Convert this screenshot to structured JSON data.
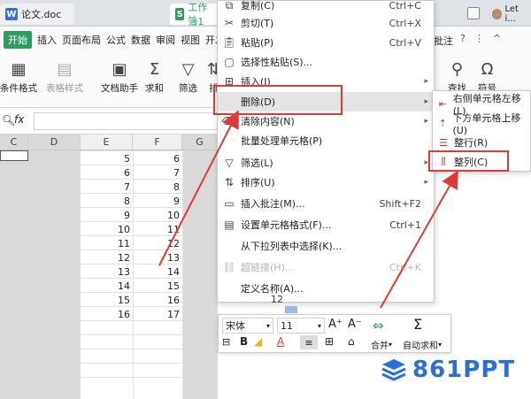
{
  "tabs": {
    "doc": "论文.doc",
    "sheet": "工作簿1",
    "user": "Let i..."
  },
  "menubar": [
    "开始",
    "插入",
    "页面布局",
    "公式",
    "数据",
    "审阅",
    "视图",
    "开发工具"
  ],
  "menubar_right": "批注",
  "toolbar": {
    "cond_format": "条件格式",
    "table_style": "表格样式",
    "doc_helper": "文档助手",
    "sum": "求和",
    "filter": "筛选",
    "sort": "排",
    "find": "查找",
    "symbol": "符号"
  },
  "formula": {
    "name_label": "Q",
    "fx": "fx"
  },
  "columns": [
    "C",
    "D",
    "E",
    "F",
    "G"
  ],
  "grid_values": {
    "E": [
      "5",
      "6",
      "7",
      "8",
      "9",
      "10",
      "11",
      "12",
      "13",
      "14",
      "15",
      "16"
    ],
    "F": [
      "6",
      "7",
      "8",
      "9",
      "10",
      "11",
      "12",
      "13",
      "14",
      "15",
      "16",
      "17"
    ]
  },
  "partial_cell": "12",
  "context_menu": {
    "copy": "复制(C)",
    "copy_sc": "Ctrl+C",
    "cut": "剪切(T)",
    "cut_sc": "Ctrl+X",
    "paste": "粘贴(P)",
    "paste_sc": "Ctrl+V",
    "paste_special": "选择性粘贴(S)...",
    "insert": "插入(I)",
    "delete": "删除(D)",
    "clear": "清除内容(N)",
    "batch": "批量处理单元格(P)",
    "filter": "筛选(L)",
    "sort": "排序(U)",
    "comment": "插入批注(M)...",
    "comment_sc": "Shift+F2",
    "format": "设置单元格格式(F)...",
    "format_sc": "Ctrl+1",
    "pick": "从下拉列表中选择(K)...",
    "hyperlink": "超链接(H)...",
    "hyperlink_sc": "Ctrl+K",
    "define_name": "定义名称(A)..."
  },
  "submenu": {
    "shift_left": "右侧单元格左移(L)",
    "shift_up": "下方单元格上移(U)",
    "entire_row": "整行(R)",
    "entire_col": "整列(C)"
  },
  "mini_toolbar": {
    "font": "宋体",
    "size": "11",
    "bold": "B",
    "merge": "合并",
    "autosum": "自动求和"
  },
  "watermark": "861PPT",
  "colors": {
    "accent_green": "#2d9d5e",
    "highlight_red": "#e03a36",
    "watermark_blue": "#2a6fd8"
  }
}
